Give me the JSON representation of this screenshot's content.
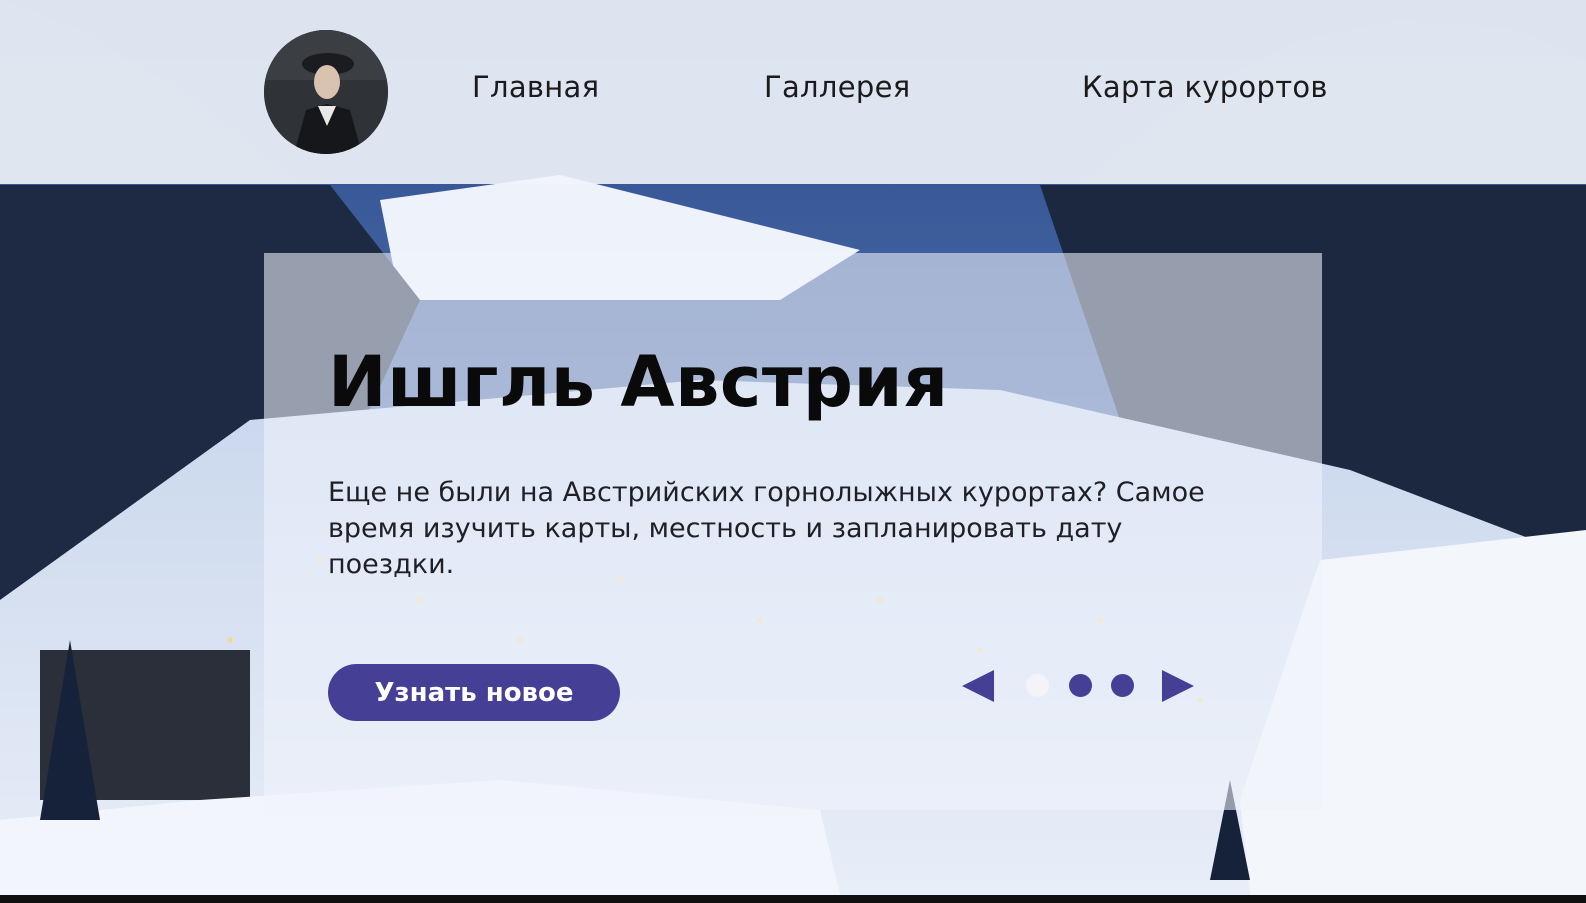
{
  "nav": {
    "items": [
      {
        "label": "Главная"
      },
      {
        "label": "Галлерея"
      },
      {
        "label": "Карта курортов"
      }
    ]
  },
  "hero": {
    "title": "Ишгль Австрия",
    "description": "Еще не были на Австрийских горнолыжных курортах? Самое время изучить карты, местность и запланировать дату поездки.",
    "cta_label": "Узнать новое"
  },
  "slider": {
    "total_slides": 3,
    "active_slide": 1
  },
  "colors": {
    "accent": "#453f96",
    "header_bg": "#f1f5fb",
    "card_bg": "#eff3fb",
    "dot_active": "#f4f4f8"
  }
}
